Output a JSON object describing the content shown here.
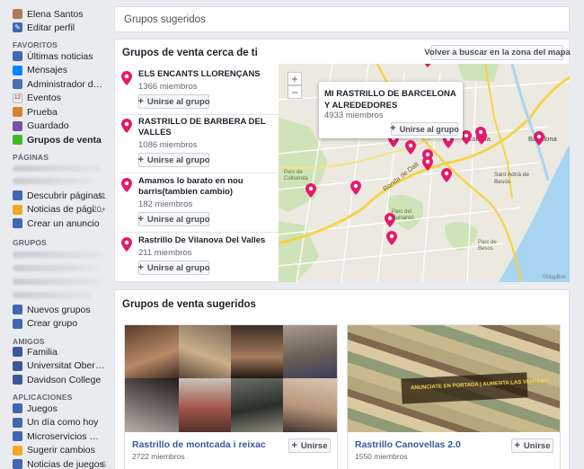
{
  "sidebar": {
    "profile": {
      "name": "Elena Santos",
      "edit": "Editar perfil"
    },
    "favorites": {
      "heading": "FAVORITOS",
      "items": [
        {
          "label": "Últimas noticias",
          "icon": "news-feed-icon",
          "color": "#4267b2",
          "extra": "▾"
        },
        {
          "label": "Mensajes",
          "icon": "messenger-icon",
          "color": "#0084ff"
        },
        {
          "label": "Administrador de a...",
          "icon": "ads-manager-icon",
          "color": "#4b6eb0"
        },
        {
          "label": "Eventos",
          "icon": "calendar-icon",
          "color": "#e9ebee",
          "glyph": "12"
        },
        {
          "label": "Prueba",
          "icon": "prueba-page-icon",
          "color": "#d9822b"
        },
        {
          "label": "Guardado",
          "icon": "bookmark-icon",
          "color": "#7b4ea8"
        },
        {
          "label": "Grupos de venta",
          "icon": "sale-groups-icon",
          "color": "#42b72a"
        }
      ]
    },
    "pages": {
      "heading": "PÁGINAS",
      "items": [
        {
          "label": "Descubrir páginas",
          "icon": "discover-pages-icon",
          "color": "#4267b2",
          "count": "11"
        },
        {
          "label": "Noticias de páginas",
          "icon": "pages-feed-icon",
          "color": "#f5a623",
          "count": "20+"
        },
        {
          "label": "Crear un anuncio",
          "icon": "create-ad-icon",
          "color": "#4267b2"
        }
      ]
    },
    "groups": {
      "heading": "GRUPOS",
      "items": [
        {
          "label": "Nuevos grupos",
          "icon": "new-groups-icon",
          "color": "#4267b2"
        },
        {
          "label": "Crear grupo",
          "icon": "create-group-icon",
          "color": "#4267b2"
        }
      ]
    },
    "friends": {
      "heading": "AMIGOS",
      "items": [
        {
          "label": "Familia",
          "icon": "family-icon",
          "color": "#3b5998"
        },
        {
          "label": "Universitat Oberta d...",
          "icon": "university-icon",
          "color": "#3b5998"
        },
        {
          "label": "Davidson College",
          "icon": "college-icon",
          "color": "#3b5998"
        }
      ]
    },
    "apps": {
      "heading": "APLICACIONES",
      "items": [
        {
          "label": "Juegos",
          "icon": "games-icon",
          "color": "#4267b2"
        },
        {
          "label": "Un día como hoy",
          "icon": "on-this-day-icon",
          "color": "#4267b2"
        },
        {
          "label": "Microservicios Quiz",
          "icon": "quiz-app-icon",
          "color": "#4267b2"
        },
        {
          "label": "Sugerir cambios",
          "icon": "suggest-edits-icon",
          "color": "#f5a623"
        },
        {
          "label": "Noticias de juegos",
          "icon": "games-feed-icon",
          "color": "#4267b2",
          "count": "6"
        }
      ]
    }
  },
  "main": {
    "page_title": "Grupos sugeridos",
    "nearby": {
      "heading": "Grupos de venta cerca de ti",
      "redo_search": "Volver a buscar en la zona del mapa",
      "join_label": "Unirse al grupo",
      "groups": [
        {
          "name": "ELS ENCANTS LLORENÇANS",
          "members": "1366 miembros"
        },
        {
          "name": "RASTRILLO DE BARBERA DEL VALLES",
          "members": "1086 miembros"
        },
        {
          "name": "Amamos lo barato en nou barris(tambien cambio)",
          "members": "182 miembros"
        },
        {
          "name": "Rastrillo De Vilanova Del Valles",
          "members": "211 miembros"
        }
      ]
    },
    "map": {
      "zoom_in": "+",
      "zoom_out": "−",
      "popup": {
        "name": "MI RASTRILLO DE BARCELONA Y ALREDEDORES",
        "members": "4933 miembros",
        "join": "Unirse al grupo"
      },
      "labels": {
        "road": "Ronda de Dalt",
        "coloma": "Coloma",
        "badalona": "Badalona",
        "sant_adria": "Sant Adrià de Besòs",
        "parc_guinardo": "Parc del Guinardó",
        "parc_collserola": "Parc de Collserola",
        "parc_besos": "Parc de Besòs",
        "credit": "©MapBox"
      },
      "pin_color": "#e4196b"
    },
    "suggested": {
      "heading": "Grupos de venta sugeridos",
      "join_label": "Unirse",
      "groups": [
        {
          "name": "Rastrillo de montcada i reixac",
          "members": "2722 miembros"
        },
        {
          "name": "Rastrillo Canovellas 2.0",
          "members": "1550 miembros"
        }
      ],
      "banner_text": "ANUNCIATE EN PORTADA | AUMENTA LAS VENTAS!!!"
    }
  },
  "colors": {
    "link": "#365899",
    "accent": "#4267b2",
    "pin": "#e4196b"
  }
}
